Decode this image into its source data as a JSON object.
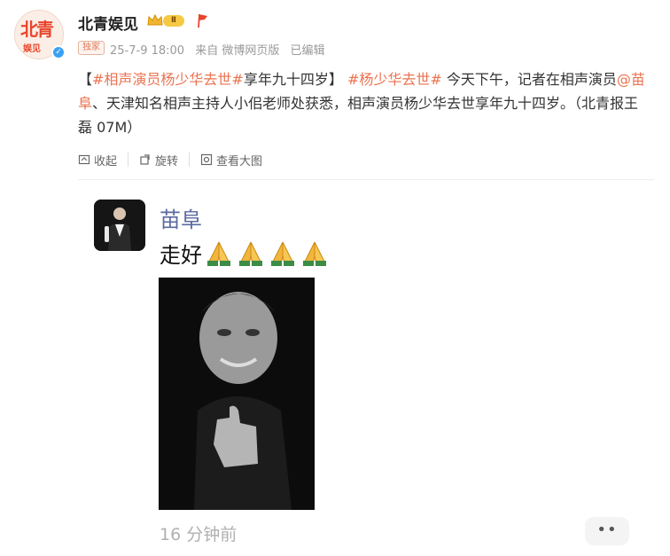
{
  "account": {
    "avatar_text": "北青",
    "avatar_sub": "娱见",
    "name": "北青娱见",
    "vip_level": "Ⅱ",
    "exclusive_tag": "独家",
    "date": "25-7-9 18:00",
    "source": "来自 微博网页版",
    "edited": "已编辑"
  },
  "post": {
    "open_bracket": "【",
    "tag1": "#相声演员杨少华去世#",
    "headline": "享年九十四岁",
    "close_bracket": "】",
    "tag2": "#杨少华去世#",
    "text1": " 今天下午，记者在相声演员",
    "mention": "@苗阜",
    "text2": "、天津知名相声主持人小佀老师处获悉，相声演员杨少华去世享年九十四岁。（北青报王磊 07M）"
  },
  "actions": {
    "collapse": "收起",
    "rotate": "旋转",
    "view_large": "查看大图"
  },
  "embedded": {
    "name": "苗阜",
    "text": "走好",
    "emoji": "pray-icon",
    "timestamp": "16 分钟前",
    "more": "••"
  },
  "colors": {
    "accent": "#eb7350",
    "name_blue": "#5b6aa0",
    "verified": "#3aa1f2"
  }
}
